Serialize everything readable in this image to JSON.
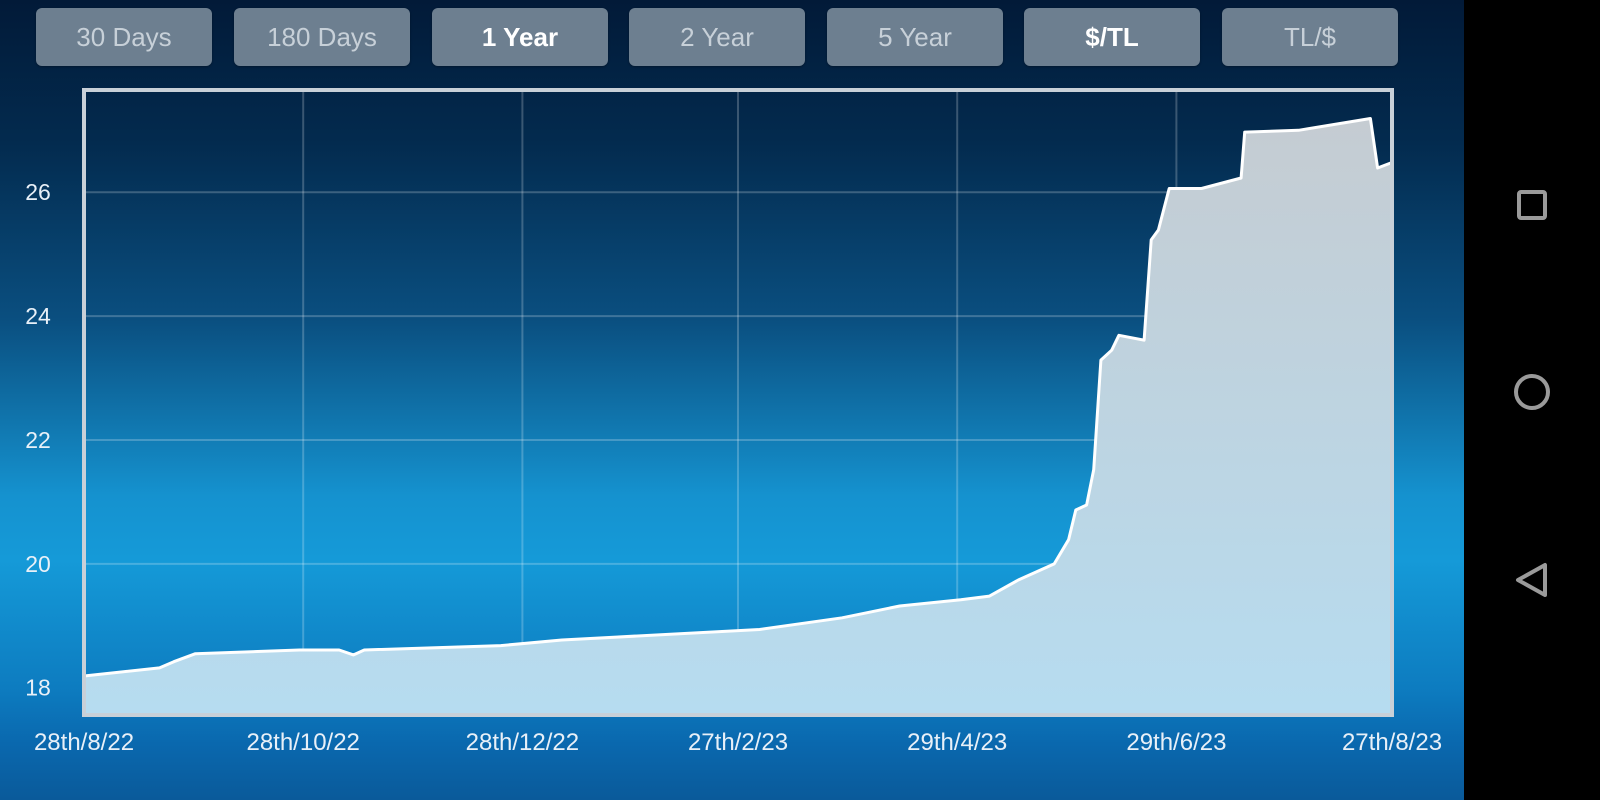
{
  "tabs": [
    {
      "label": "30 Days",
      "active": false
    },
    {
      "label": "180 Days",
      "active": false
    },
    {
      "label": "1 Year",
      "active": true
    },
    {
      "label": "2 Year",
      "active": false
    },
    {
      "label": "5 Year",
      "active": false
    },
    {
      "label": "$/TL",
      "active": true
    },
    {
      "label": "TL/$",
      "active": false
    }
  ],
  "colors": {
    "tab_bg": "#6d7f90",
    "area_fill_top": "#c5ccd2",
    "area_fill_bottom": "#b6dcf0",
    "line": "#ffffff",
    "frame": "#c8d0d8"
  },
  "navbar": {
    "recents_icon": "square-icon",
    "home_icon": "circle-icon",
    "back_icon": "triangle-left-icon"
  },
  "chart_data": {
    "type": "area",
    "title": "",
    "xlabel": "",
    "ylabel": "",
    "series_name": "$/TL",
    "x_unit": "days since 28th/8/22",
    "xlim": [
      0,
      364
    ],
    "ylim": [
      17.56,
      27.65
    ],
    "yticks": [
      18,
      20,
      22,
      24,
      26
    ],
    "ytick_labels": [
      "18",
      "20",
      "22",
      "24",
      "26"
    ],
    "xticks": [
      0,
      61,
      122,
      182,
      243,
      304,
      364
    ],
    "xtick_labels": [
      "28th/8/22",
      "28th/10/22",
      "28th/12/22",
      "27th/2/23",
      "29th/4/23",
      "29th/6/23",
      "27th/8/23"
    ],
    "grid": true,
    "legend": "none",
    "x": [
      0,
      21,
      25,
      31,
      60,
      71,
      75,
      78,
      116,
      133,
      188,
      211,
      227,
      244,
      252,
      260,
      270,
      274,
      276,
      279,
      281,
      283,
      286,
      288,
      295,
      297,
      299,
      302,
      311,
      322,
      323,
      338,
      358,
      360,
      364
    ],
    "y": [
      18.19,
      18.32,
      18.42,
      18.55,
      18.61,
      18.61,
      18.53,
      18.61,
      18.68,
      18.77,
      18.94,
      19.13,
      19.32,
      19.42,
      19.48,
      19.74,
      20.0,
      20.39,
      20.87,
      20.95,
      21.52,
      23.29,
      23.45,
      23.69,
      23.61,
      25.23,
      25.39,
      26.06,
      26.06,
      26.23,
      26.97,
      27.0,
      27.19,
      26.39,
      26.48
    ]
  }
}
